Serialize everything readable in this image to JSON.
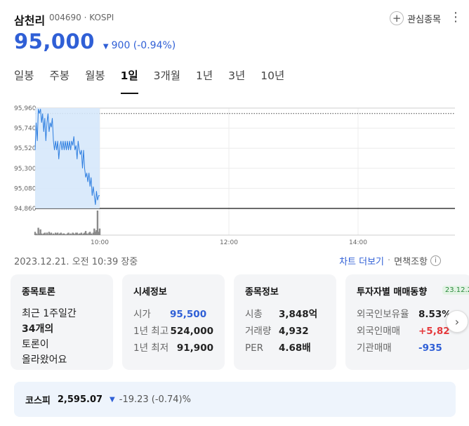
{
  "stock": {
    "name": "삼천리",
    "code_market": "004690 · KOSPI",
    "price": "95,000",
    "change": "900 (-0.94%)",
    "favorite_label": "관심종목"
  },
  "tabs": [
    "일봉",
    "주봉",
    "월봉",
    "1일",
    "3개월",
    "1년",
    "3년",
    "10년"
  ],
  "active_tab": "1일",
  "chart_data": {
    "type": "line",
    "y_ticks": [
      "95,960",
      "95,740",
      "95,520",
      "95,300",
      "95,080",
      "94,860"
    ],
    "x_ticks": [
      "10:00",
      "12:00",
      "14:00"
    ],
    "ylim": [
      94860,
      95960
    ],
    "prev_close": 95900,
    "price_series": [
      {
        "t": "09:00",
        "v": 95500
      },
      {
        "t": "09:01",
        "v": 95800
      },
      {
        "t": "09:02",
        "v": 95600
      },
      {
        "t": "09:03",
        "v": 95950
      },
      {
        "t": "09:04",
        "v": 95900
      },
      {
        "t": "09:05",
        "v": 95950
      },
      {
        "t": "09:06",
        "v": 95800
      },
      {
        "t": "09:07",
        "v": 95900
      },
      {
        "t": "09:08",
        "v": 95700
      },
      {
        "t": "09:09",
        "v": 95850
      },
      {
        "t": "09:10",
        "v": 95600
      },
      {
        "t": "09:11",
        "v": 95800
      },
      {
        "t": "09:12",
        "v": 95900
      },
      {
        "t": "09:13",
        "v": 95700
      },
      {
        "t": "09:14",
        "v": 95800
      },
      {
        "t": "09:15",
        "v": 95750
      },
      {
        "t": "09:16",
        "v": 95850
      },
      {
        "t": "09:17",
        "v": 95600
      },
      {
        "t": "09:18",
        "v": 95500
      },
      {
        "t": "09:19",
        "v": 95600
      },
      {
        "t": "09:20",
        "v": 95500
      },
      {
        "t": "09:21",
        "v": 95600
      },
      {
        "t": "09:22",
        "v": 95400
      },
      {
        "t": "09:23",
        "v": 95550
      },
      {
        "t": "09:24",
        "v": 95600
      },
      {
        "t": "09:25",
        "v": 95500
      },
      {
        "t": "09:26",
        "v": 95600
      },
      {
        "t": "09:27",
        "v": 95500
      },
      {
        "t": "09:28",
        "v": 95600
      },
      {
        "t": "09:29",
        "v": 95500
      },
      {
        "t": "09:30",
        "v": 95600
      },
      {
        "t": "09:31",
        "v": 95500
      },
      {
        "t": "09:32",
        "v": 95600
      },
      {
        "t": "09:33",
        "v": 95500
      },
      {
        "t": "09:34",
        "v": 95600
      },
      {
        "t": "09:35",
        "v": 95550
      },
      {
        "t": "09:36",
        "v": 95650
      },
      {
        "t": "09:37",
        "v": 95500
      },
      {
        "t": "09:38",
        "v": 95550
      },
      {
        "t": "09:39",
        "v": 95400
      },
      {
        "t": "09:40",
        "v": 95600
      },
      {
        "t": "09:41",
        "v": 95500
      },
      {
        "t": "09:42",
        "v": 95450
      },
      {
        "t": "09:43",
        "v": 95500
      },
      {
        "t": "09:44",
        "v": 95300
      },
      {
        "t": "09:45",
        "v": 95500
      },
      {
        "t": "09:46",
        "v": 95300
      },
      {
        "t": "09:47",
        "v": 95200
      },
      {
        "t": "09:48",
        "v": 95250
      },
      {
        "t": "09:49",
        "v": 95150
      },
      {
        "t": "09:50",
        "v": 95250
      },
      {
        "t": "09:51",
        "v": 95100
      },
      {
        "t": "09:52",
        "v": 95200
      },
      {
        "t": "09:53",
        "v": 95000
      },
      {
        "t": "09:54",
        "v": 95100
      },
      {
        "t": "09:55",
        "v": 95000
      },
      {
        "t": "09:56",
        "v": 94900
      },
      {
        "t": "09:57",
        "v": 95050
      },
      {
        "t": "09:58",
        "v": 94950
      },
      {
        "t": "09:59",
        "v": 95000
      },
      {
        "t": "10:00",
        "v": 95000
      }
    ],
    "volume": [
      4,
      2,
      1,
      9,
      2,
      7,
      2,
      1,
      2,
      3,
      1,
      3,
      1,
      4,
      2,
      3,
      1,
      2,
      1,
      3,
      2,
      3,
      1,
      2,
      3,
      1,
      2,
      2,
      1,
      1,
      2,
      3,
      1,
      2,
      1,
      3,
      2,
      1,
      3,
      3,
      1,
      2,
      2,
      3,
      1,
      2,
      3,
      5,
      2,
      1,
      3,
      4,
      2,
      1,
      3,
      8,
      4,
      6,
      30,
      4,
      8
    ]
  },
  "footer": {
    "timestamp": "2023.12.21. 오전 10:39 장중",
    "chart_more": "차트 더보기",
    "disclaimer": "면책조항"
  },
  "cards": {
    "discussion": {
      "title": "종목토론",
      "line1": "최근 1주일간",
      "line2": "34개의",
      "line3": "토론이",
      "line4": "올라왔어요"
    },
    "market": {
      "title": "시세정보",
      "rows": [
        {
          "k": "시가",
          "v": "95,500"
        },
        {
          "k": "1년 최고",
          "v": "524,000"
        },
        {
          "k": "1년 최저",
          "v": "91,900"
        }
      ]
    },
    "stock_info": {
      "title": "종목정보",
      "rows": [
        {
          "k": "시총",
          "v": "3,848억"
        },
        {
          "k": "거래량",
          "v": "4,932"
        },
        {
          "k": "PER",
          "v": "4.68배"
        }
      ]
    },
    "investor": {
      "title": "투자자별 매매동향",
      "date": "23.12.2",
      "rows": [
        {
          "k": "외국인보유율",
          "v": "8.53%"
        },
        {
          "k": "외국인매매",
          "v": "+5,82"
        },
        {
          "k": "기관매매",
          "v": "-935"
        }
      ]
    }
  },
  "index": {
    "name": "코스피",
    "value": "2,595.07",
    "change": "-19.23 (-0.74)%"
  },
  "colors": {
    "down_blue": "#2f5fd6",
    "up_red": "#e5383b",
    "chart_fill": "#d6e8fb",
    "chart_line": "#2f7fe0"
  }
}
